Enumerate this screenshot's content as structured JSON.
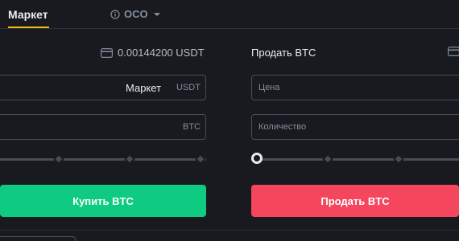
{
  "tabs": {
    "market": "Маркет",
    "oco": "OCO"
  },
  "buy": {
    "balance": "0.00144200 USDT",
    "price_field": {
      "value": "Маркет",
      "unit": "USDT"
    },
    "amount_field": {
      "unit": "BTC"
    },
    "slider_percent": 0,
    "button": "Купить BTC"
  },
  "sell": {
    "title": "Продать BTC",
    "price_field": {
      "placeholder": "Цена"
    },
    "amount_field": {
      "placeholder": "Количество"
    },
    "slider_percent": 0,
    "button": "Продать BTC"
  },
  "colors": {
    "accent": "#f0b90b",
    "buy": "#0ecb81",
    "sell": "#f6465d",
    "background": "#181a20"
  },
  "icons": {
    "oco_info": "info-icon",
    "oco_menu": "caret-down-icon",
    "balance": "wallet-icon"
  }
}
